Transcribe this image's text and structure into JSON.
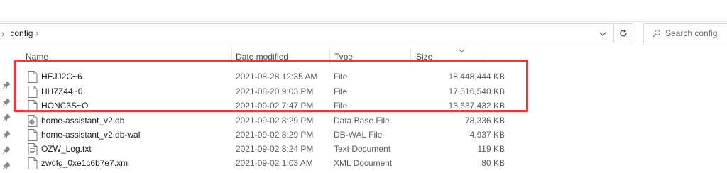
{
  "address": {
    "breadcrumb": "config"
  },
  "search": {
    "placeholder": "Search config"
  },
  "columns": {
    "name": "Name",
    "date_modified": "Date modified",
    "type": "Type",
    "size": "Size"
  },
  "files": [
    {
      "name": "HEJJ2C~6",
      "date": "2021-08-28 12:35 AM",
      "type": "File",
      "size": "18,448,444 KB",
      "icon": "blank-file-icon"
    },
    {
      "name": "HH7Z44~0",
      "date": "2021-08-20 9:03 PM",
      "type": "File",
      "size": "17,516,540 KB",
      "icon": "blank-file-icon"
    },
    {
      "name": "HONC3S~O",
      "date": "2021-09-02 7:47 PM",
      "type": "File",
      "size": "13,637,432 KB",
      "icon": "blank-file-icon"
    },
    {
      "name": "home-assistant_v2.db",
      "date": "2021-09-02 8:29 PM",
      "type": "Data Base File",
      "size": "78,336 KB",
      "icon": "database-file-icon"
    },
    {
      "name": "home-assistant_v2.db-wal",
      "date": "2021-09-02 8:29 PM",
      "type": "DB-WAL File",
      "size": "4,937 KB",
      "icon": "blank-file-icon"
    },
    {
      "name": "OZW_Log.txt",
      "date": "2021-09-02 8:24 PM",
      "type": "Text Document",
      "size": "119 KB",
      "icon": "text-file-icon"
    },
    {
      "name": "zwcfg_0xe1c6b7e7.xml",
      "date": "2021-09-02 1:03 AM",
      "type": "XML Document",
      "size": "80 KB",
      "icon": "blank-file-icon"
    }
  ],
  "colors": {
    "highlight": "#e53a3e"
  }
}
